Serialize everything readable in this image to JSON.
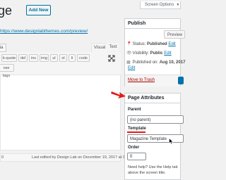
{
  "header": {
    "title_fragment": "ge",
    "add_new_label": "Add New",
    "screen_options_label": "Screen Options",
    "screen_options_caret": "▼"
  },
  "permalink": "https://www.designlabthemes.com/preview/",
  "editor": {
    "add_media_fragment": "dia",
    "tabs": {
      "visual": "Visual",
      "text": "Text"
    },
    "quicktags": [
      "b-quote",
      "del",
      "ins",
      "img",
      "ul",
      "ol",
      "li",
      "code"
    ],
    "close_tags_fragment": "ose tags",
    "word_count": "0",
    "last_edited": "Last edited by Design Lab on December 19, 2017 at 3:52 pm"
  },
  "publish": {
    "title": "Publish",
    "preview_label": "Preview",
    "status_label": "Status:",
    "status_value": "Published",
    "status_edit": "Edit",
    "visibility_label": "Visibility:",
    "visibility_value": "Public",
    "visibility_edit": "Edit",
    "published_label": "Published on:",
    "published_value": "Aug 10, 2017",
    "published_edit": "Edit",
    "move_to_trash": "Move to Trash"
  },
  "page_attributes": {
    "title": "Page Attributes",
    "parent_label": "Parent",
    "parent_value": "(no parent)",
    "template_label": "Template",
    "template_value": "Magazine Template",
    "order_label": "Order",
    "order_value": "0",
    "help_text": "Need help? Use the Help tab above the screen title."
  },
  "colors": {
    "accent": "#0073aa",
    "annotation_red": "#e01b1b",
    "trash_red": "#aa0000"
  }
}
